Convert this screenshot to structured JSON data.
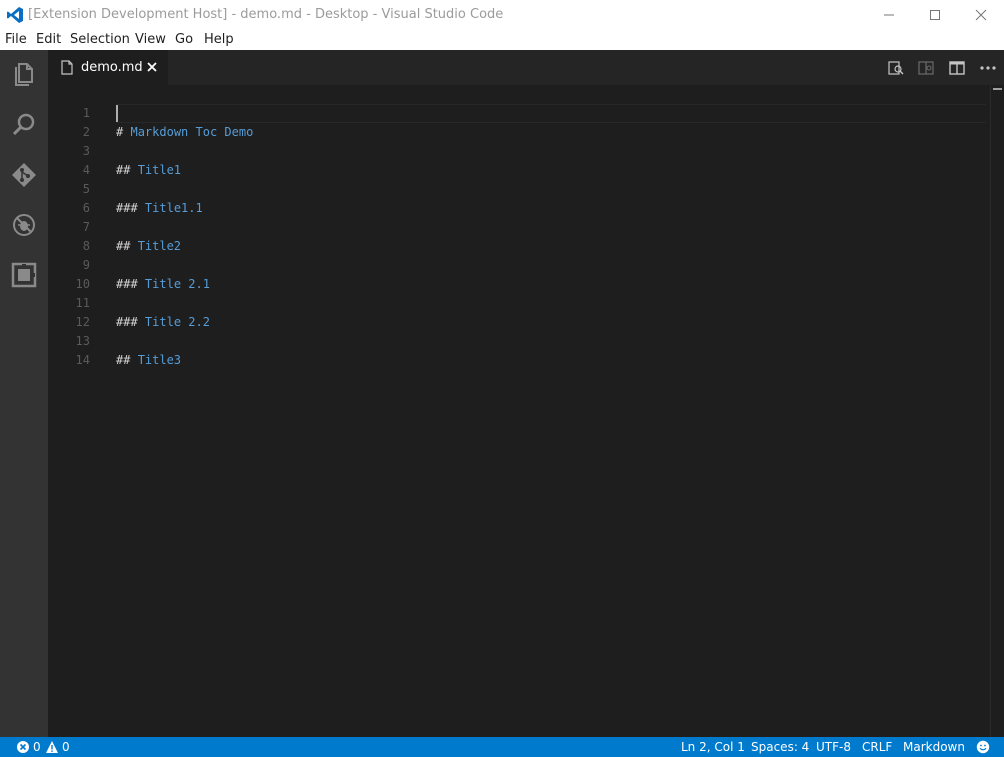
{
  "window": {
    "title": "[Extension Development Host] - demo.md - Desktop - Visual Studio Code",
    "controls": [
      "minimize-icon",
      "maximize-icon",
      "close-icon"
    ]
  },
  "menu": {
    "items": [
      "File",
      "Edit",
      "Selection",
      "View",
      "Go",
      "Help"
    ]
  },
  "activity_bar": {
    "icons": [
      "explorer-icon",
      "search-icon",
      "source-control-icon",
      "debug-icon",
      "extensions-icon"
    ]
  },
  "tabs": [
    {
      "label": "demo.md",
      "active": true
    }
  ],
  "editor_actions": [
    "open-preview-icon",
    "open-preview-side-icon",
    "split-editor-icon",
    "more-actions-icon"
  ],
  "editor": {
    "lines": [
      {
        "number": "1",
        "hashes": "#",
        "text": "Markdown Toc Demo"
      },
      {
        "number": "2",
        "hashes": "",
        "text": ""
      },
      {
        "number": "3",
        "hashes": "##",
        "text": "Title1"
      },
      {
        "number": "4",
        "hashes": "",
        "text": ""
      },
      {
        "number": "5",
        "hashes": "###",
        "text": "Title1.1"
      },
      {
        "number": "6",
        "hashes": "",
        "text": ""
      },
      {
        "number": "7",
        "hashes": "##",
        "text": "Title2"
      },
      {
        "number": "8",
        "hashes": "",
        "text": ""
      },
      {
        "number": "9",
        "hashes": "###",
        "text": "Title 2.1"
      },
      {
        "number": "10",
        "hashes": "",
        "text": ""
      },
      {
        "number": "11",
        "hashes": "###",
        "text": "Title 2.2"
      },
      {
        "number": "12",
        "hashes": "",
        "text": ""
      },
      {
        "number": "13",
        "hashes": "##",
        "text": "Title3"
      },
      {
        "number": "14",
        "hashes": "",
        "text": ""
      }
    ]
  },
  "status_bar": {
    "errors": "0",
    "warnings": "0",
    "cursor_position": "Ln 2, Col 1",
    "indentation": "Spaces: 4",
    "encoding": "UTF-8",
    "line_ending": "CRLF",
    "language": "Markdown",
    "feedback_icon": "smiley-icon"
  },
  "colors": {
    "accent": "#007acc",
    "editor_background": "#1e1e1e",
    "activity_bar": "#333333",
    "tabs_bar": "#252526",
    "heading_text": "#569cd6",
    "markup_text": "#d4d4d4",
    "line_number": "#5a5a5a"
  }
}
